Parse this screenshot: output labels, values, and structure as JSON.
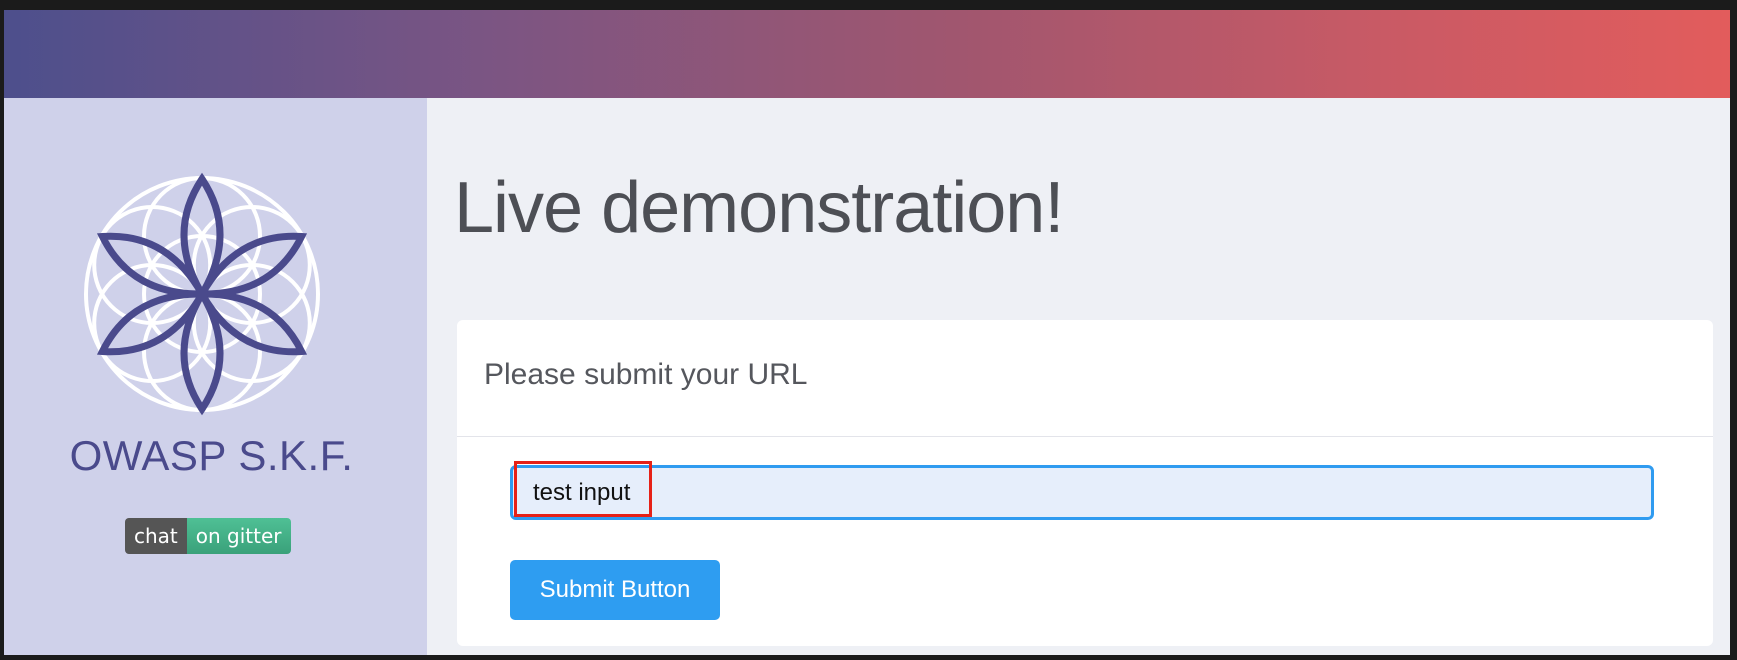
{
  "header": {
    "gradient_start": "#4d4f8c",
    "gradient_end": "#e25c5c"
  },
  "sidebar": {
    "logo_icon": "flower-of-life-icon",
    "brand_name": "OWASP S.K.F.",
    "badge": {
      "left_text": "chat",
      "right_text": "on gitter"
    },
    "background": "#cfd1ea"
  },
  "main": {
    "title": "Live demonstration!",
    "form": {
      "heading": "Please submit your URL",
      "input_value": "test input",
      "submit_label": "Submit Button"
    }
  },
  "colors": {
    "accent": "#2e9df1",
    "highlight": "#e62117",
    "brand": "#4a4a8c"
  }
}
